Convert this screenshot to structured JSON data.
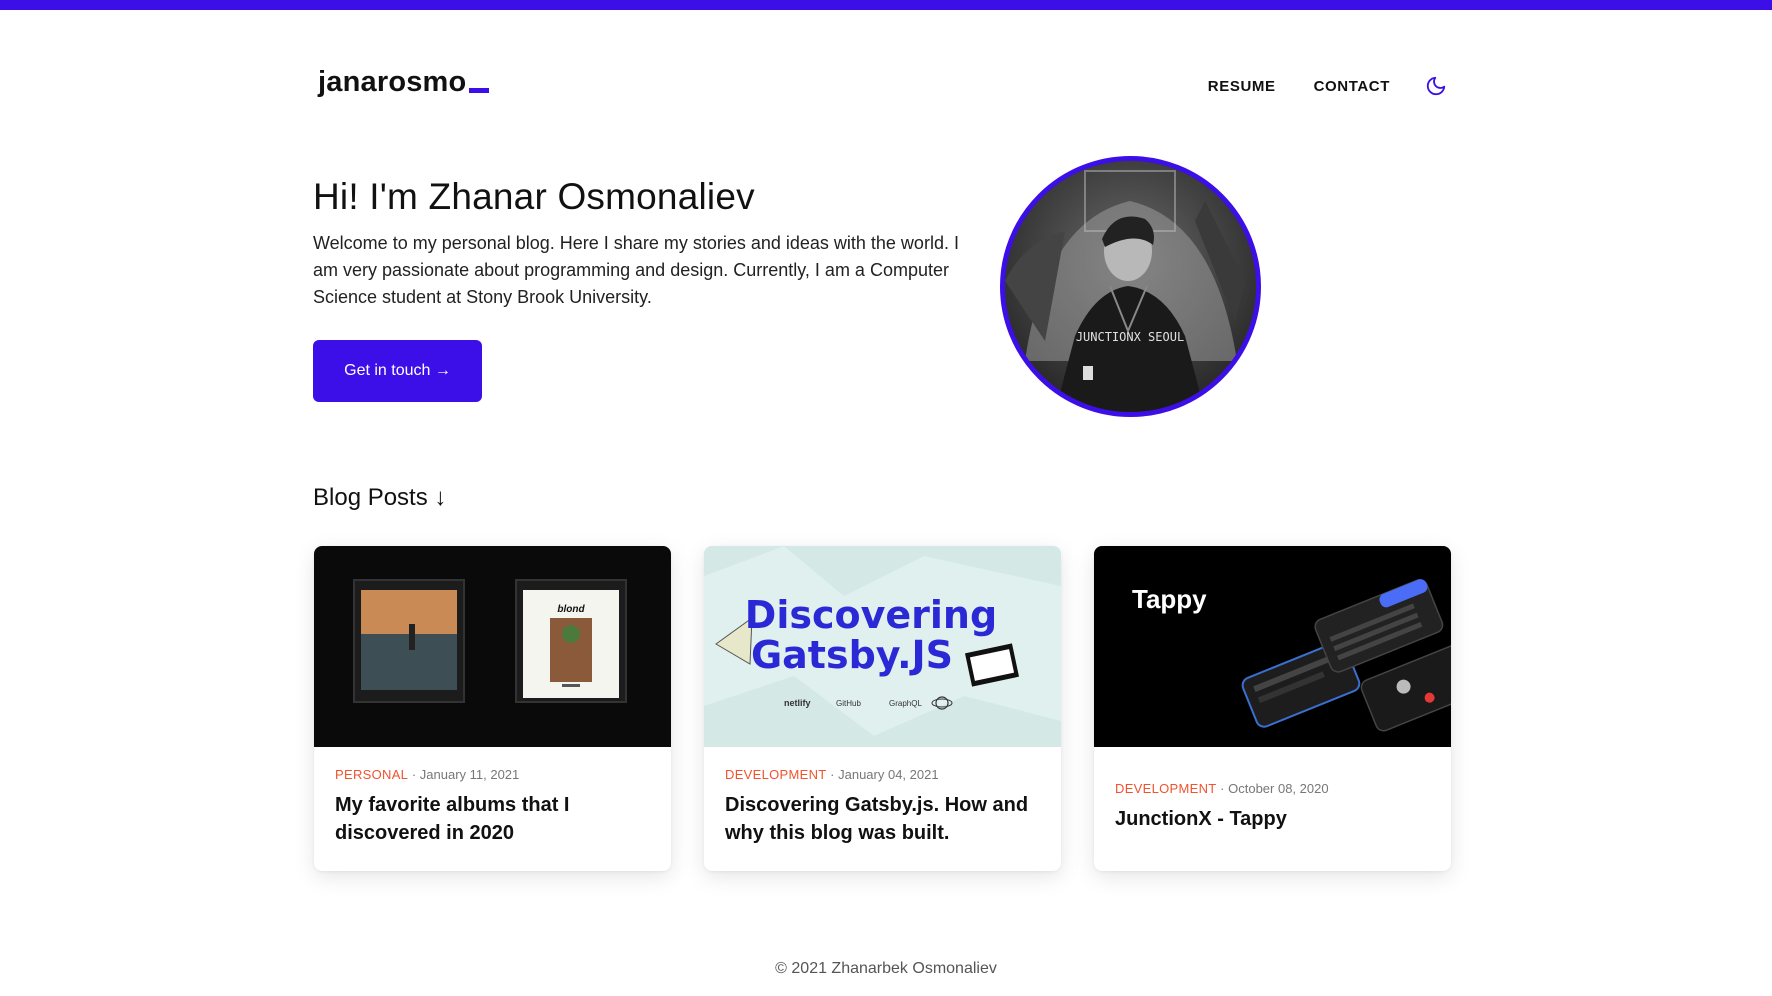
{
  "colors": {
    "accent": "#3d0fe8",
    "category": "#f2522e"
  },
  "header": {
    "logo_text": "janarosmo",
    "nav": {
      "resume": "RESUME",
      "contact": "CONTACT"
    },
    "theme_icon": "moon-icon"
  },
  "hero": {
    "title": "Hi! I'm Zhanar Osmonaliev",
    "text": "Welcome to my personal blog. Here I share my stories and ideas with the world. I am very passionate about programming and design. Currently, I am a Computer Science student at Stony Brook University.",
    "cta": "Get in touch →",
    "avatar_shirt": "JUNCTIONX SEOUL"
  },
  "blog": {
    "heading": "Blog Posts ↓",
    "posts": [
      {
        "category": "PERSONAL",
        "date": "· January 11, 2021",
        "title": "My favorite albums that I discovered in 2020",
        "cover_label": "blond"
      },
      {
        "category": "DEVELOPMENT",
        "date": "· January 04, 2021",
        "title": "Discovering Gatsby.js. How and why this blog was built.",
        "cover_line1": "Discovering",
        "cover_line2": "Gatsby.JS",
        "cover_logos": [
          "netlify",
          "GitHub",
          "GraphQL"
        ]
      },
      {
        "category": "DEVELOPMENT",
        "date": "· October 08, 2020",
        "title": "JunctionX - Tappy",
        "cover_label": "Tappy"
      }
    ]
  },
  "footer": {
    "text": "© 2021 Zhanarbek Osmonaliev"
  }
}
